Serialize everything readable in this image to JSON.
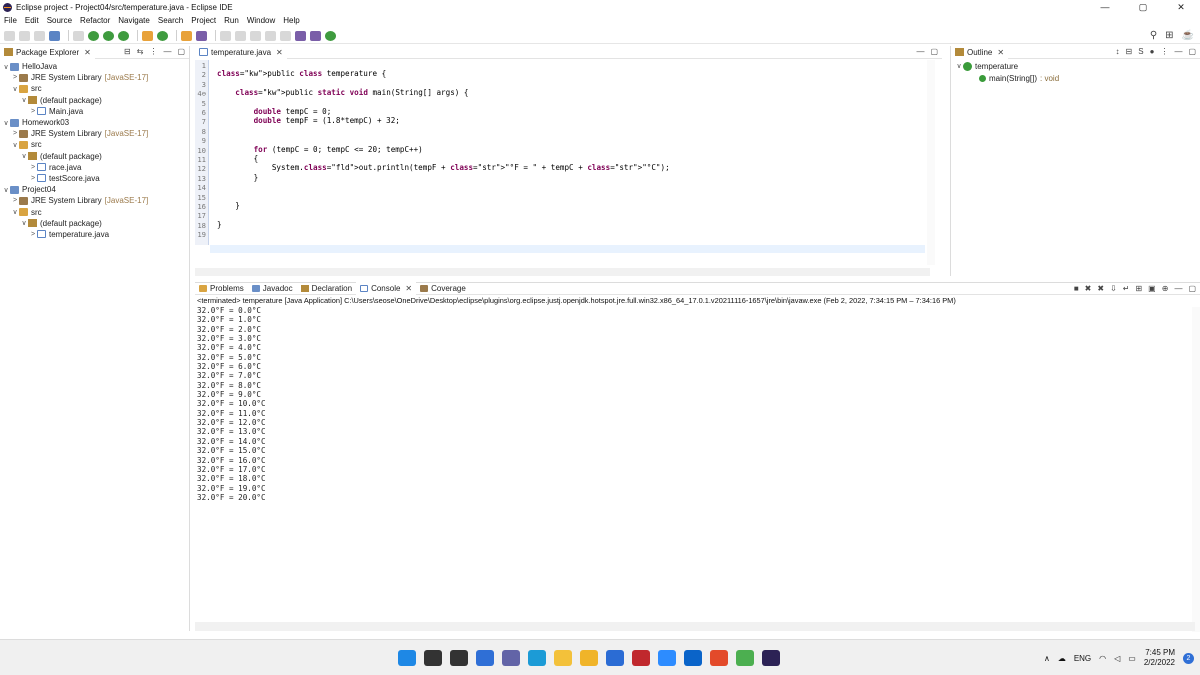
{
  "window": {
    "title": "Eclipse project - Project04/src/temperature.java - Eclipse IDE",
    "controls": {
      "minimize": "—",
      "maximize": "▢",
      "close": "✕"
    }
  },
  "menu": [
    "File",
    "Edit",
    "Source",
    "Refactor",
    "Navigate",
    "Search",
    "Project",
    "Run",
    "Window",
    "Help"
  ],
  "explorer": {
    "tab_label": "Package Explorer",
    "items": [
      {
        "label": "HelloJava",
        "depth": 0,
        "icon": "project-icon",
        "chev": "∨"
      },
      {
        "label": "JRE System Library",
        "tag": "[JavaSE-17]",
        "depth": 1,
        "icon": "library-icon",
        "chev": ">"
      },
      {
        "label": "src",
        "depth": 1,
        "icon": "source-folder-icon",
        "chev": "∨"
      },
      {
        "label": "(default package)",
        "depth": 2,
        "icon": "package-icon",
        "chev": "∨"
      },
      {
        "label": "Main.java",
        "depth": 3,
        "icon": "java-file-icon",
        "chev": ">"
      },
      {
        "label": "Homework03",
        "depth": 0,
        "icon": "project-icon",
        "chev": "∨"
      },
      {
        "label": "JRE System Library",
        "tag": "[JavaSE-17]",
        "depth": 1,
        "icon": "library-icon",
        "chev": ">"
      },
      {
        "label": "src",
        "depth": 1,
        "icon": "source-folder-icon",
        "chev": "∨"
      },
      {
        "label": "(default package)",
        "depth": 2,
        "icon": "package-icon",
        "chev": "∨"
      },
      {
        "label": "race.java",
        "depth": 3,
        "icon": "java-file-icon",
        "chev": ">"
      },
      {
        "label": "testScore.java",
        "depth": 3,
        "icon": "java-file-icon",
        "chev": ">"
      },
      {
        "label": "Project04",
        "depth": 0,
        "icon": "project-icon",
        "chev": "∨"
      },
      {
        "label": "JRE System Library",
        "tag": "[JavaSE-17]",
        "depth": 1,
        "icon": "library-icon",
        "chev": ">"
      },
      {
        "label": "src",
        "depth": 1,
        "icon": "source-folder-icon",
        "chev": "∨"
      },
      {
        "label": "(default package)",
        "depth": 2,
        "icon": "package-icon",
        "chev": "∨"
      },
      {
        "label": "temperature.java",
        "depth": 3,
        "icon": "java-file-icon",
        "chev": ">"
      }
    ]
  },
  "editor": {
    "tab_label": "temperature.java",
    "line_numbers": [
      "1",
      "2",
      "3",
      "4⊖",
      "5",
      "6",
      "7",
      "8",
      "9",
      "10",
      "11",
      "12",
      "13",
      "14",
      "15",
      "16",
      "17",
      "18",
      "19"
    ],
    "code": [
      "",
      "public class temperature {",
      "",
      "    public static void main(String[] args) {",
      "",
      "        double tempC = 0;",
      "        double tempF = (1.8*tempC) + 32;",
      "",
      "",
      "        for (tempC = 0; tempC <= 20; tempC++)",
      "        {",
      "            System.out.println(tempF + \"°F = \" + tempC + \"°C\");",
      "        }",
      "",
      "",
      "    }",
      "",
      "}",
      ""
    ]
  },
  "outline": {
    "tab_label": "Outline",
    "class_name": "temperature",
    "method": "main(String[])",
    "method_return": ": void"
  },
  "console": {
    "tabs": [
      "Problems",
      "Javadoc",
      "Declaration",
      "Console",
      "Coverage"
    ],
    "status": "<terminated> temperature [Java Application] C:\\Users\\seose\\OneDrive\\Desktop\\eclipse\\plugins\\org.eclipse.justj.openjdk.hotspot.jre.full.win32.x86_64_17.0.1.v20211116-1657\\jre\\bin\\javaw.exe  (Feb 2, 2022, 7:34:15 PM – 7:34:16 PM)",
    "output": [
      "32.0°F = 0.0°C",
      "32.0°F = 1.0°C",
      "32.0°F = 2.0°C",
      "32.0°F = 3.0°C",
      "32.0°F = 4.0°C",
      "32.0°F = 5.0°C",
      "32.0°F = 6.0°C",
      "32.0°F = 7.0°C",
      "32.0°F = 8.0°C",
      "32.0°F = 9.0°C",
      "32.0°F = 10.0°C",
      "32.0°F = 11.0°C",
      "32.0°F = 12.0°C",
      "32.0°F = 13.0°C",
      "32.0°F = 14.0°C",
      "32.0°F = 15.0°C",
      "32.0°F = 16.0°C",
      "32.0°F = 17.0°C",
      "32.0°F = 18.0°C",
      "32.0°F = 19.0°C",
      "32.0°F = 20.0°C"
    ]
  },
  "taskbar": {
    "apps": [
      {
        "name": "windows-start-icon",
        "color": "#1e88e5"
      },
      {
        "name": "search-icon",
        "color": "#333333"
      },
      {
        "name": "task-view-icon",
        "color": "#333333"
      },
      {
        "name": "widgets-icon",
        "color": "#2f6fd6"
      },
      {
        "name": "teams-icon",
        "color": "#6264a7"
      },
      {
        "name": "edge-icon",
        "color": "#1c9bd6"
      },
      {
        "name": "file-explorer-icon",
        "color": "#f3c13a"
      },
      {
        "name": "store-icon",
        "color": "#f0b429"
      },
      {
        "name": "mail-icon",
        "color": "#2b6cd4"
      },
      {
        "name": "mcafee-icon",
        "color": "#c0282d"
      },
      {
        "name": "zoom-icon",
        "color": "#2d8cff"
      },
      {
        "name": "outlook-icon",
        "color": "#0a64c9"
      },
      {
        "name": "office-icon",
        "color": "#e34a2a"
      },
      {
        "name": "chrome-icon",
        "color": "#4caf50"
      },
      {
        "name": "eclipse-icon",
        "color": "#2c2255"
      }
    ],
    "language": "ENG",
    "time": "7:45 PM",
    "date": "2/2/2022",
    "notifications": "2"
  }
}
